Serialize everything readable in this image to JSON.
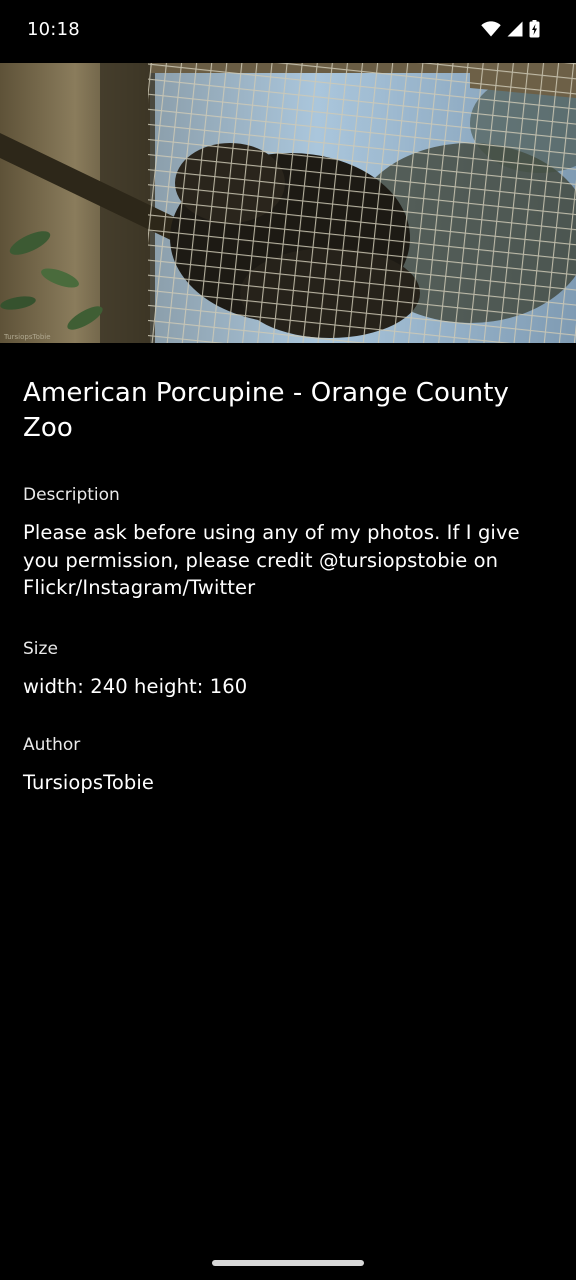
{
  "status_bar": {
    "time": "10:18",
    "icons": [
      "wifi-icon",
      "cellular-signal-icon",
      "battery-charging-icon"
    ]
  },
  "photo": {
    "subject": "porcupine behind wire mesh",
    "watermark": "TursiopsTobie"
  },
  "details": {
    "title": "American Porcupine - Orange County Zoo",
    "description_label": "Description",
    "description": "Please ask before using any of my photos. If I give you permission, please credit @tursiopstobie on Flickr/Instagram/Twitter",
    "size_label": "Size",
    "size": "width: 240 height: 160",
    "author_label": "Author",
    "author": "TursiopsTobie"
  },
  "colors": {
    "background": "#000000",
    "text": "#ffffff",
    "nav_handle": "#d8d8d8"
  }
}
